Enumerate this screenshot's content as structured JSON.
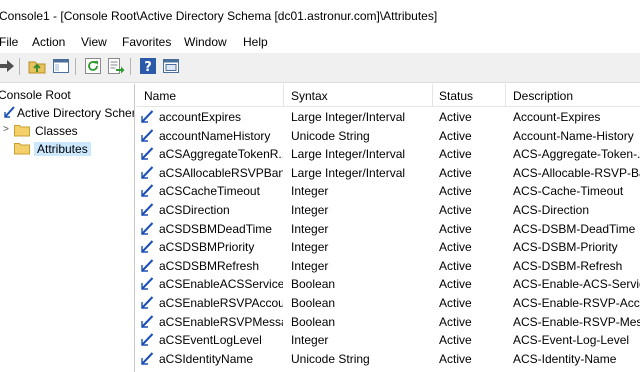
{
  "window": {
    "title": "Console1 - [Console Root\\Active Directory Schema [dc01.astronur.com]\\Attributes]"
  },
  "menu": [
    "File",
    "Action",
    "View",
    "Favorites",
    "Window",
    "Help"
  ],
  "toolbar_icons": [
    "forward-icon",
    "up-folder-icon",
    "show-hide-tree-icon",
    "refresh-icon",
    "export-list-icon",
    "help-icon",
    "properties-icon"
  ],
  "tree": {
    "root": "Console Root",
    "schema": "Active Directory Scher",
    "classes": "Classes",
    "attributes": "Attributes"
  },
  "columns": [
    "Name",
    "Syntax",
    "Status",
    "Description"
  ],
  "rows": [
    {
      "name": "accountExpires",
      "syntax": "Large Integer/Interval",
      "status": "Active",
      "desc": "Account-Expires"
    },
    {
      "name": "accountNameHistory",
      "syntax": "Unicode String",
      "status": "Active",
      "desc": "Account-Name-History"
    },
    {
      "name": "aCSAggregateTokenR...",
      "syntax": "Large Integer/Interval",
      "status": "Active",
      "desc": "ACS-Aggregate-Token-..."
    },
    {
      "name": "aCSAllocableRSVPBan...",
      "syntax": "Large Integer/Interval",
      "status": "Active",
      "desc": "ACS-Allocable-RSVP-Ba..."
    },
    {
      "name": "aCSCacheTimeout",
      "syntax": "Integer",
      "status": "Active",
      "desc": "ACS-Cache-Timeout"
    },
    {
      "name": "aCSDirection",
      "syntax": "Integer",
      "status": "Active",
      "desc": "ACS-Direction"
    },
    {
      "name": "aCSDSBMDeadTime",
      "syntax": "Integer",
      "status": "Active",
      "desc": "ACS-DSBM-DeadTime"
    },
    {
      "name": "aCSDSBMPriority",
      "syntax": "Integer",
      "status": "Active",
      "desc": "ACS-DSBM-Priority"
    },
    {
      "name": "aCSDSBMRefresh",
      "syntax": "Integer",
      "status": "Active",
      "desc": "ACS-DSBM-Refresh"
    },
    {
      "name": "aCSEnableACSService",
      "syntax": "Boolean",
      "status": "Active",
      "desc": "ACS-Enable-ACS-Service"
    },
    {
      "name": "aCSEnableRSVPAccou...",
      "syntax": "Boolean",
      "status": "Active",
      "desc": "ACS-Enable-RSVP-Acco..."
    },
    {
      "name": "aCSEnableRSVPMessa...",
      "syntax": "Boolean",
      "status": "Active",
      "desc": "ACS-Enable-RSVP-Mess..."
    },
    {
      "name": "aCSEventLogLevel",
      "syntax": "Integer",
      "status": "Active",
      "desc": "ACS-Event-Log-Level"
    },
    {
      "name": "aCSIdentityName",
      "syntax": "Unicode String",
      "status": "Active",
      "desc": "ACS-Identity-Name"
    }
  ]
}
